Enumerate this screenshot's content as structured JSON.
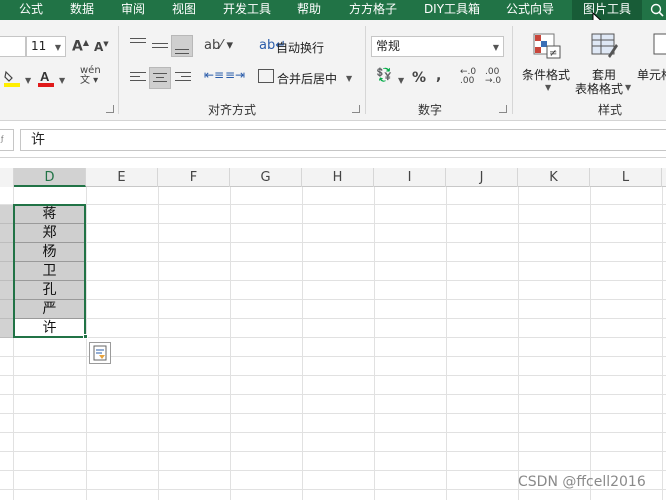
{
  "tabs": [
    "公式",
    "数据",
    "审阅",
    "视图",
    "开发工具",
    "帮助",
    "方方格子",
    "DIY工具箱",
    "公式向导",
    "图片工具"
  ],
  "active_tab": "图片工具",
  "font": {
    "size": "11"
  },
  "alignment": {
    "wrap_text": "自动换行",
    "merge_center": "合并后居中",
    "group_label": "对齐方式"
  },
  "number": {
    "format": "常规",
    "percent": "%",
    "comma": ",",
    "inc_decimal": "←.0 .00",
    "dec_decimal": ".00 →.0",
    "group_label": "数字"
  },
  "styles": {
    "conditional_format": "条件格式",
    "format_as_table_line1": "套用",
    "format_as_table_line2": "表格格式",
    "cell_styles": "单元格",
    "group_label": "样式"
  },
  "formula_bar": {
    "value": "许"
  },
  "columns": [
    "D",
    "E",
    "F",
    "G",
    "H",
    "I",
    "J",
    "K",
    "L"
  ],
  "cells_D": [
    "蒋",
    "郑",
    "杨",
    "卫",
    "孔",
    "严",
    "许"
  ],
  "watermark": "CSDN @ffcell2016",
  "colors": {
    "brand": "#217346",
    "selection": "#cfcfcf"
  }
}
